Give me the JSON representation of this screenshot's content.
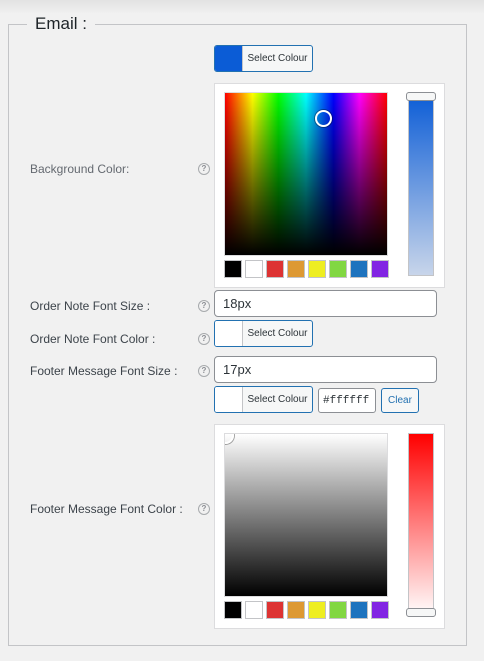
{
  "section": {
    "title": "Email :"
  },
  "button_label": "Select Colour",
  "background_color": {
    "label": "Background Color:",
    "value_color": "#0b5cd6",
    "palette": [
      "#000000",
      "#ffffff",
      "#dd3333",
      "#dd9933",
      "#eeee22",
      "#81d742",
      "#1e73be",
      "#8224e3"
    ]
  },
  "order_note_font_size": {
    "label": "Order Note Font Size :",
    "value": "18px"
  },
  "order_note_font_color": {
    "label": "Order Note Font Color :",
    "value_color": "#ffffff"
  },
  "footer_message_font_size": {
    "label": "Footer Message Font Size :",
    "value": "17px"
  },
  "footer_message_font_color": {
    "label": "Footer Message Font Color :",
    "value_color": "#ffffff",
    "hex_value": "#ffffff",
    "clear_label": "Clear",
    "palette": [
      "#000000",
      "#ffffff",
      "#dd3333",
      "#dd9933",
      "#eeee22",
      "#81d742",
      "#1e73be",
      "#8224e3"
    ]
  },
  "help_icon": "help-circle-icon"
}
